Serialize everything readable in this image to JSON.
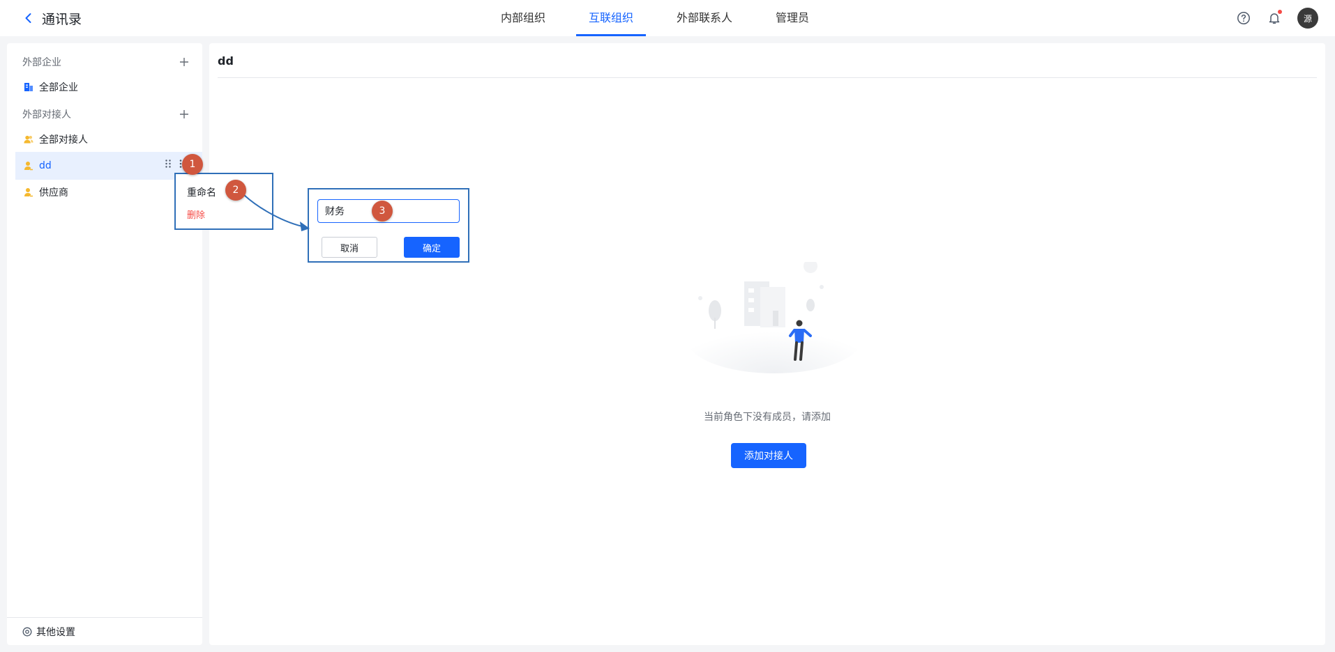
{
  "header": {
    "title": "通讯录",
    "tabs": [
      {
        "label": "内部组织"
      },
      {
        "label": "互联组织"
      },
      {
        "label": "外部联系人"
      },
      {
        "label": "管理员"
      }
    ],
    "active_tab": "互联组织",
    "avatar_text": "源"
  },
  "sidebar": {
    "section_companies": "外部企业",
    "all_companies": "全部企业",
    "section_contacts": "外部对接人",
    "all_contacts": "全部对接人",
    "items": [
      {
        "label": "dd"
      },
      {
        "label": "供应商"
      }
    ],
    "bottom": "其他设置"
  },
  "context_menu": {
    "rename": "重命名",
    "delete": "删除"
  },
  "rename_popover": {
    "value": "财务",
    "cancel": "取消",
    "confirm": "确定"
  },
  "badges": [
    "1",
    "2",
    "3"
  ],
  "main": {
    "title": "dd",
    "empty_text": "当前角色下没有成员，请添加",
    "add_button": "添加对接人"
  },
  "colors": {
    "accent": "#1664ff",
    "danger": "#f54a45",
    "badge": "#d0573e",
    "annotation_border": "#2f6fb8"
  }
}
